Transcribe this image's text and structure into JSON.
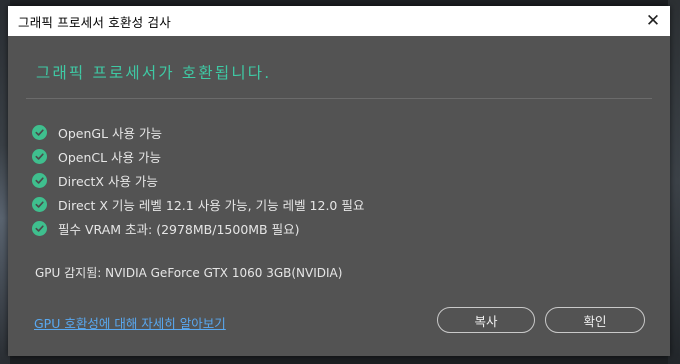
{
  "window": {
    "title": "그래픽 프로세서 호환성 검사",
    "close_label": "✕"
  },
  "heading": "그래픽 프로세서가 호환됩니다.",
  "checks": [
    {
      "label": "OpenGL 사용 가능"
    },
    {
      "label": "OpenCL 사용 가능"
    },
    {
      "label": "DirectX 사용 가능"
    },
    {
      "label": "Direct X 기능 레벨 12.1 사용 가능, 기능 레벨 12.0 필요"
    },
    {
      "label": "필수 VRAM 초과: (2978MB/1500MB 필요)"
    }
  ],
  "gpu_detected": "GPU 감지됨: NVIDIA GeForce GTX 1060 3GB(NVIDIA)",
  "learn_more_link": "GPU 호환성에 대해 자세히 알아보기",
  "buttons": {
    "copy": "복사",
    "ok": "확인"
  },
  "colors": {
    "accent": "#3fc9a4",
    "check": "#3fbf8e",
    "link": "#59a8f0",
    "dialog_bg": "#535353"
  }
}
